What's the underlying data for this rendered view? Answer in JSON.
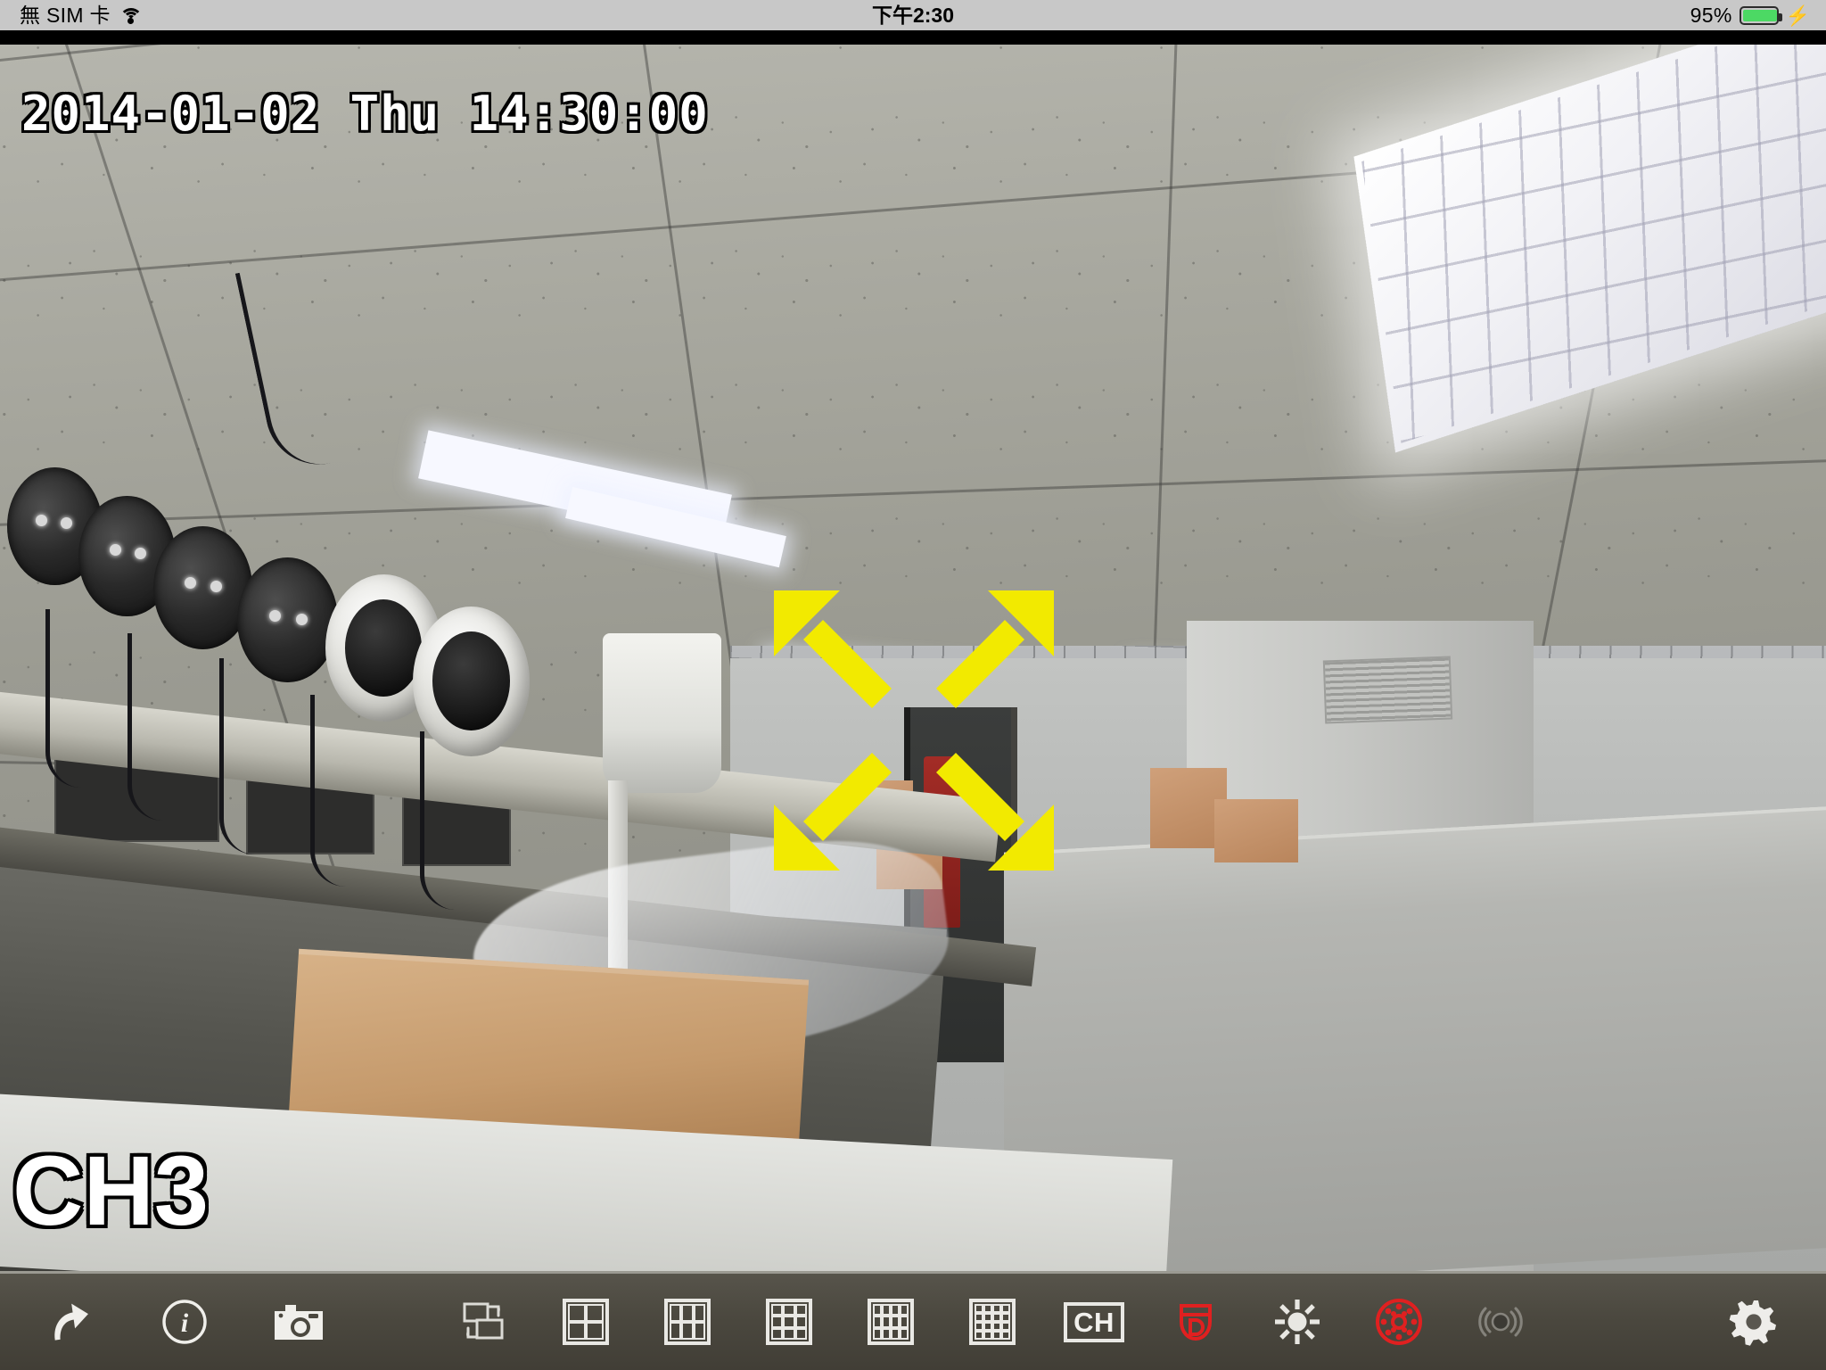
{
  "status_bar": {
    "carrier": "無 SIM 卡",
    "wifi_icon": "wifi-icon",
    "time": "下午2:30",
    "battery_percent": "95%",
    "battery_level": 95,
    "charging_icon": "lightning-bolt-icon",
    "battery_color": "#4cd964",
    "background_color": "#c8c8c8"
  },
  "video": {
    "timestamp": "2014-01-02 Thu 14:30:00",
    "channel_label": "CH3",
    "zoom_overlay_icon": "four-diagonal-arrows-expand-icon",
    "zoom_overlay_color": "#f2ea00",
    "scene_description": "office ceiling with security cameras on shelf"
  },
  "toolbar": {
    "background_color": "#4b483f",
    "accent_red": "#e02020",
    "items": [
      {
        "name": "back-button",
        "icon": "curved-up-arrow-icon",
        "label": "Back",
        "state": "enabled"
      },
      {
        "name": "info-button",
        "icon": "info-circle-icon",
        "label": "Info",
        "state": "enabled"
      },
      {
        "name": "snapshot-button",
        "icon": "camera-icon",
        "label": "Snapshot",
        "state": "enabled"
      },
      {
        "name": "sequence-button",
        "icon": "screen-swap-icon",
        "label": "Sequence",
        "state": "enabled"
      },
      {
        "name": "layout-4-button",
        "icon": "grid-2x2-icon",
        "label": "4",
        "state": "enabled"
      },
      {
        "name": "layout-6-button",
        "icon": "grid-3x2-icon",
        "label": "6",
        "state": "enabled"
      },
      {
        "name": "layout-9-button",
        "icon": "grid-3x3-icon",
        "label": "9",
        "state": "enabled"
      },
      {
        "name": "layout-12-button",
        "icon": "grid-4x3-icon",
        "label": "12",
        "state": "enabled"
      },
      {
        "name": "layout-16-button",
        "icon": "grid-4x4-icon",
        "label": "16",
        "state": "enabled"
      },
      {
        "name": "channel-button",
        "icon": "ch-box-icon",
        "label": "CH",
        "state": "enabled"
      },
      {
        "name": "dome-ptz-button",
        "icon": "dome-shield-d-icon",
        "label": "Dome",
        "state": "active"
      },
      {
        "name": "brightness-button",
        "icon": "sun-icon",
        "label": "Brightness",
        "state": "enabled"
      },
      {
        "name": "ir-led-button",
        "icon": "ir-led-ring-icon",
        "label": "IR LED",
        "state": "active"
      },
      {
        "name": "audio-button",
        "icon": "audio-waves-icon",
        "label": "Audio",
        "state": "disabled"
      },
      {
        "name": "settings-button",
        "icon": "gear-icon",
        "label": "Settings",
        "state": "enabled"
      }
    ]
  }
}
